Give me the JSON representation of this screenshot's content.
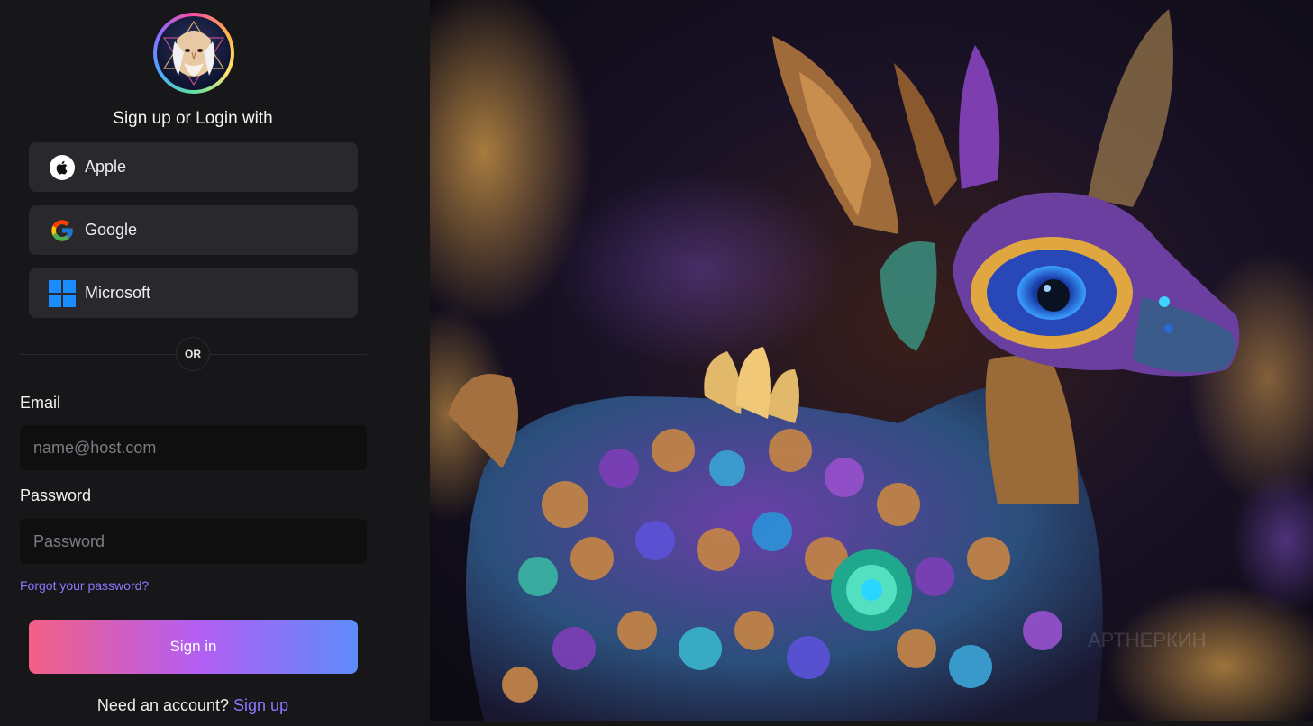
{
  "login": {
    "title": "Sign up or Login with",
    "providers": [
      {
        "label": "Apple",
        "icon": "apple-icon"
      },
      {
        "label": "Google",
        "icon": "google-icon"
      },
      {
        "label": "Microsoft",
        "icon": "microsoft-icon"
      }
    ],
    "divider": "OR",
    "email": {
      "label": "Email",
      "placeholder": "name@host.com"
    },
    "password": {
      "label": "Password",
      "placeholder": "Password"
    },
    "forgot": "Forgot your password?",
    "signin_label": "Sign in",
    "signup_prompt": "Need an account?",
    "signup_link": "Sign up"
  },
  "hero": {
    "watermark": "АРТНЕРКИН",
    "description": "Jeweled deer-like creature with flower-covered body against dark bokeh background"
  },
  "colors": {
    "panel_bg": "#171719",
    "button_bg": "#29292d",
    "input_bg": "#0f0f10",
    "link": "#8e77ff",
    "signin_gradient": [
      "#f45f86",
      "#b25ff3",
      "#5e8cfb"
    ]
  }
}
